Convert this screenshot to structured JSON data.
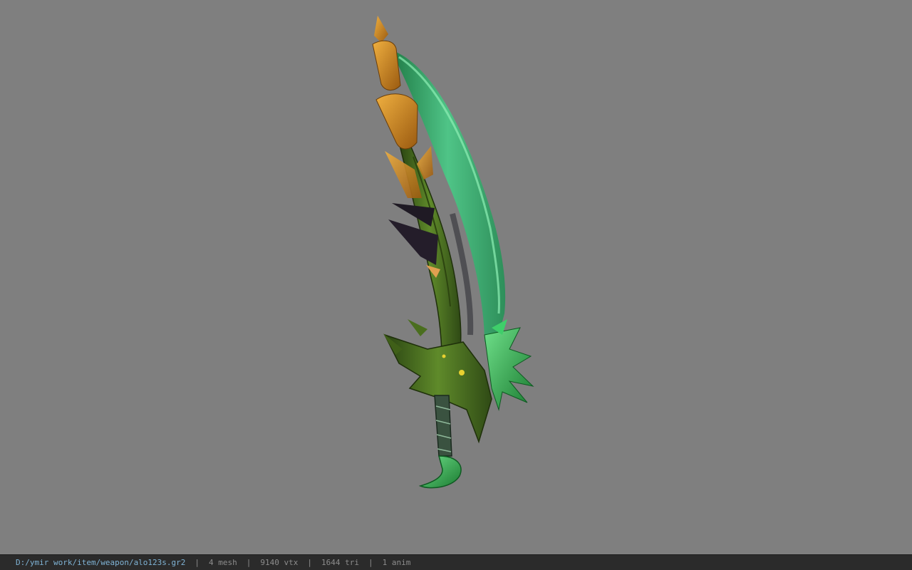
{
  "viewer": {
    "background_color": "#7f7f7f",
    "model_name": "alo123s",
    "model_colors": {
      "blade": "#3fae6e",
      "blade_highlight": "#7ee0a8",
      "spine": "#3b5a1c",
      "tip_orange": "#e29a2c",
      "dark_spike": "#1f1a24",
      "crystal": "#2fbf5a"
    }
  },
  "status_bar": {
    "file_path": "D:/ymir work/item/weapon/alo123s.gr2",
    "separator": "|",
    "mesh": "4 mesh",
    "vertices": "9140 vtx",
    "triangles": "1644 tri",
    "animations": "1 anim"
  }
}
